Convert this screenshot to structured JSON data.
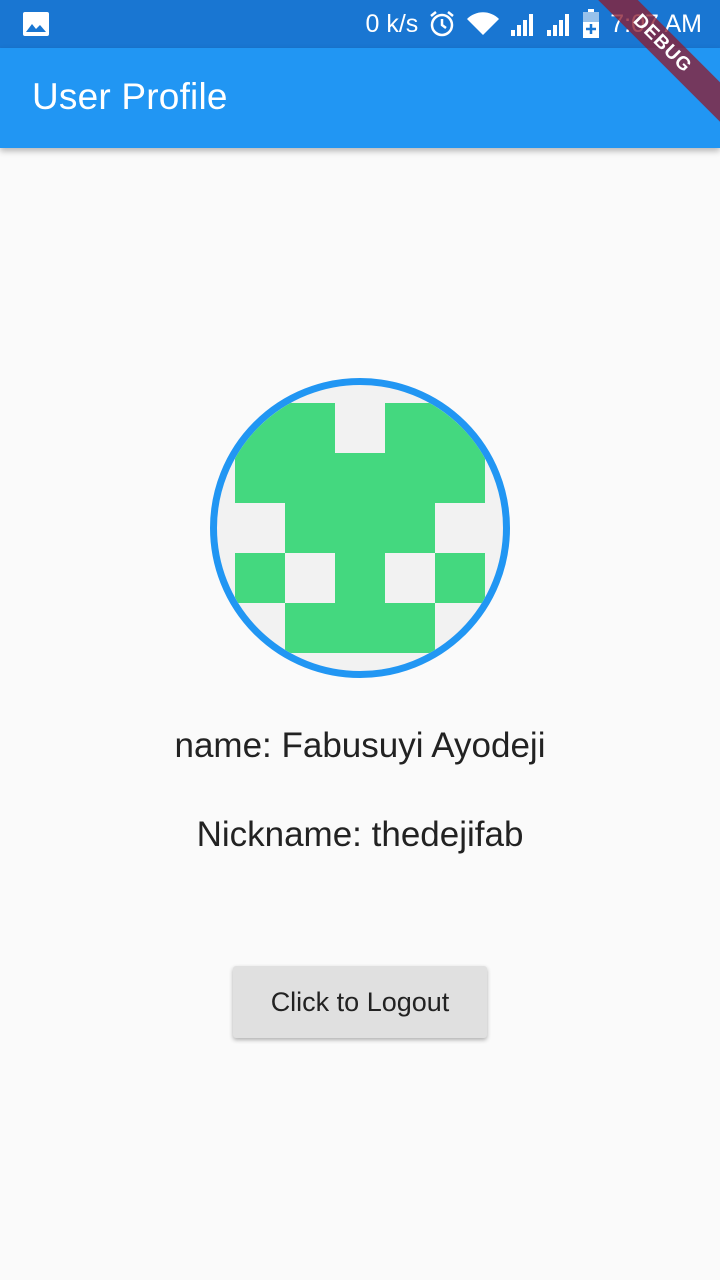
{
  "status_bar": {
    "network_speed": "0 k/s",
    "time": "7:07 AM",
    "icons": [
      "image-icon",
      "alarm-icon",
      "wifi-icon",
      "signal-icon",
      "signal-icon",
      "battery-charging-icon"
    ]
  },
  "app_bar": {
    "title": "User Profile"
  },
  "debug_banner": {
    "label": "DEBUG"
  },
  "profile": {
    "name_text": "name: Fabusuyi Ayodeji",
    "nickname_text": "Nickname: thedejifab"
  },
  "logout_button": {
    "label": "Click to Logout"
  },
  "colors": {
    "status_bar": "#1976d2",
    "app_bar": "#2196f3",
    "avatar_border": "#2196f3",
    "identicon": "#44d87f",
    "background": "#fafafa"
  }
}
